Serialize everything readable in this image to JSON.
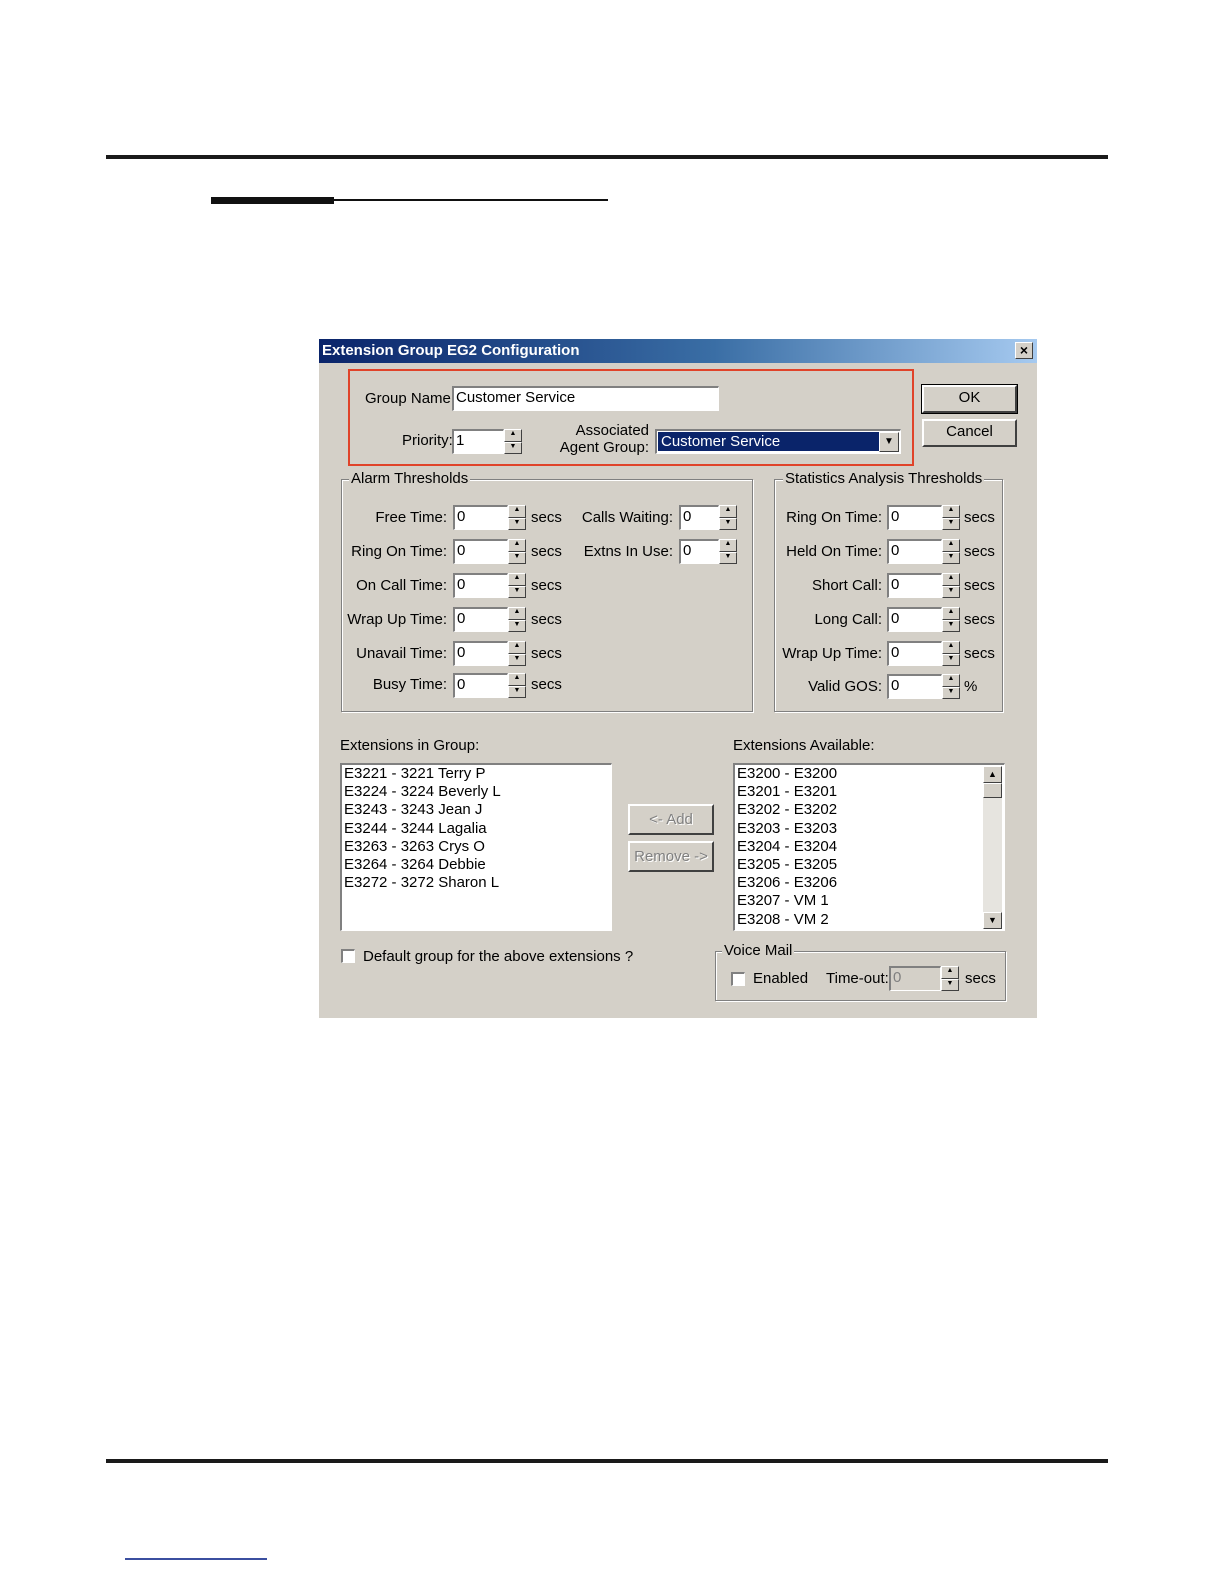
{
  "dialog": {
    "title": "Extension Group EG2 Configuration",
    "close_glyph": "×",
    "ok_label": "OK",
    "cancel_label": "Cancel"
  },
  "group": {
    "name_label": "Group Name:",
    "name_value": "Customer Service",
    "priority_label": "Priority:",
    "priority_value": "1",
    "agent_label_1": "Associated",
    "agent_label_2": "Agent Group:",
    "agent_value": "Customer Service"
  },
  "alarm": {
    "title": "Alarm Thresholds",
    "unit": "secs",
    "rows": [
      {
        "label": "Free Time:",
        "value": "0"
      },
      {
        "label": "Ring On Time:",
        "value": "0"
      },
      {
        "label": "On Call Time:",
        "value": "0"
      },
      {
        "label": "Wrap Up Time:",
        "value": "0"
      },
      {
        "label": "Unavail Time:",
        "value": "0"
      },
      {
        "label": "Busy Time:",
        "value": "0"
      }
    ],
    "calls_waiting_label": "Calls Waiting:",
    "calls_waiting_value": "0",
    "extns_in_use_label": "Extns In Use:",
    "extns_in_use_value": "0"
  },
  "stats": {
    "title": "Statistics Analysis Thresholds",
    "unit": "secs",
    "percent": "%",
    "rows": [
      {
        "label": "Ring On Time:",
        "value": "0"
      },
      {
        "label": "Held On Time:",
        "value": "0"
      },
      {
        "label": "Short Call:",
        "value": "0"
      },
      {
        "label": "Long Call:",
        "value": "0"
      },
      {
        "label": "Wrap Up Time:",
        "value": "0"
      },
      {
        "label": "Valid GOS:",
        "value": "0"
      }
    ]
  },
  "ext_group": {
    "label": "Extensions in Group:",
    "items": [
      "E3221 - 3221 Terry P",
      "E3224 - 3224 Beverly L",
      "E3243 - 3243 Jean J",
      "E3244 - 3244 Lagalia",
      "E3263 - 3263 Crys O",
      "E3264 - 3264 Debbie",
      "E3272 - 3272 Sharon L"
    ]
  },
  "ext_available": {
    "label": "Extensions Available:",
    "items": [
      "E3200 - E3200",
      "E3201 - E3201",
      "E3202 - E3202",
      "E3203 - E3203",
      "E3204 - E3204",
      "E3205 - E3205",
      "E3206 - E3206",
      "E3207 - VM 1",
      "E3208 - VM 2"
    ]
  },
  "actions": {
    "add_label": "<- Add",
    "remove_label": "Remove ->"
  },
  "default_group_label": "Default group for the above extensions ?",
  "voicemail": {
    "title": "Voice Mail",
    "enabled_label": "Enabled",
    "timeout_label": "Time-out:",
    "timeout_value": "0",
    "unit": "secs"
  }
}
